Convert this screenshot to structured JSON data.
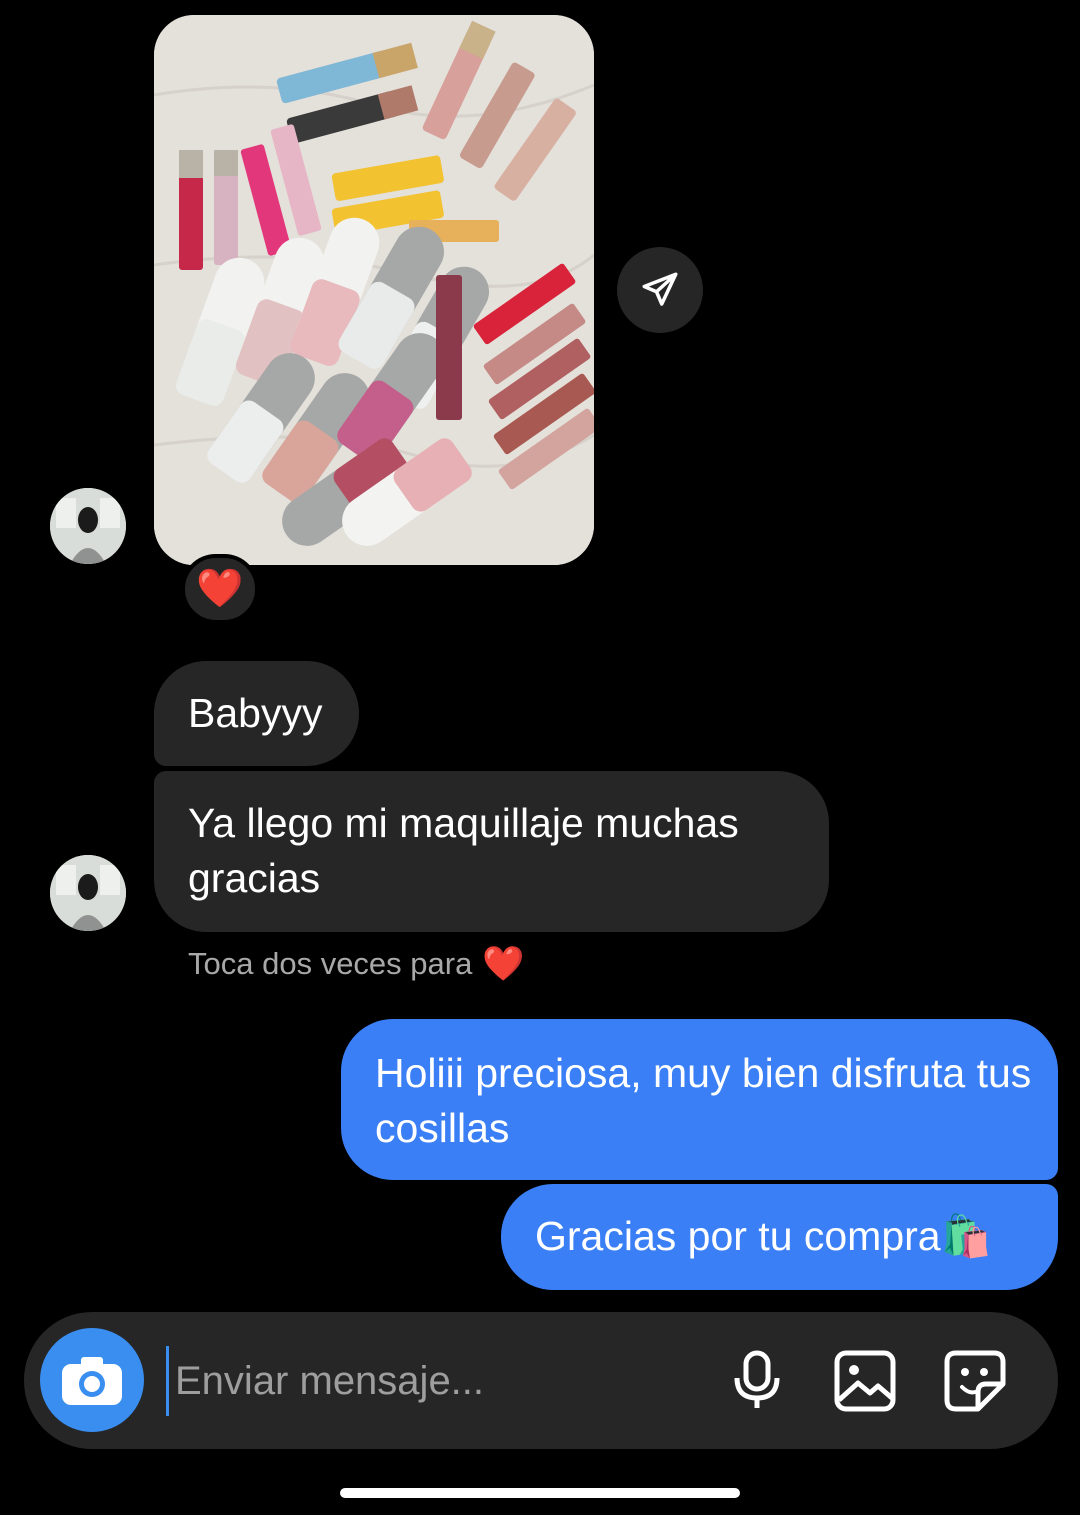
{
  "thread": {
    "photo_alt": "Shared photo of lip gloss collection",
    "reaction_emoji": "❤️",
    "messages_in": [
      {
        "text": "Babyyy"
      },
      {
        "text": "Ya llego mi maquillaje muchas gracias"
      }
    ],
    "hint": {
      "text": "Toca dos veces para",
      "emoji": "❤️"
    },
    "messages_out": [
      {
        "text": "Holiii preciosa, muy bien disfruta tus cosillas"
      },
      {
        "text": "Gracias por tu compra🛍️"
      }
    ]
  },
  "composer": {
    "placeholder": "Enviar mensaje...",
    "icons": [
      "camera-icon",
      "microphone-icon",
      "gallery-icon",
      "sticker-icon"
    ]
  },
  "colors": {
    "background": "#000000",
    "incoming_bubble": "#262626",
    "outgoing_bubble": "#3a7ff6",
    "camera_button": "#3a8ef0"
  }
}
